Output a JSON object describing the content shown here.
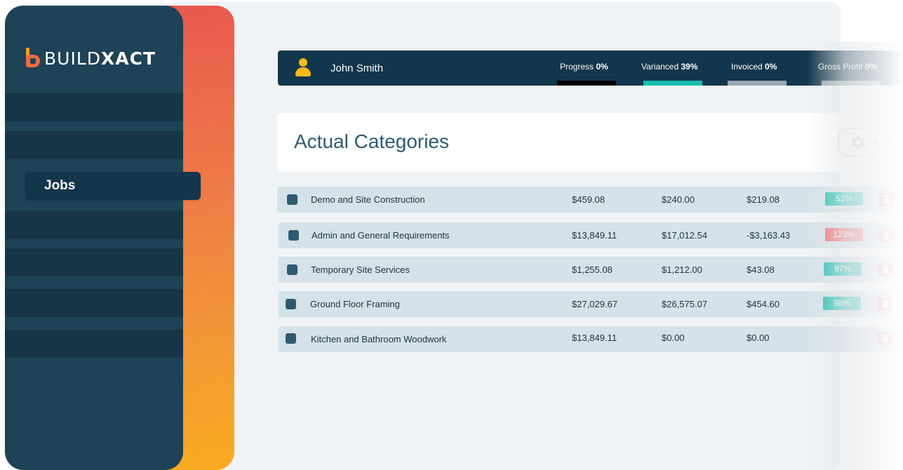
{
  "brand": {
    "logo_regular": "BUILD",
    "logo_bold": "XACT"
  },
  "sidebar": {
    "active_item": "Jobs"
  },
  "header": {
    "user_name": "John Smith",
    "stats": [
      {
        "label": "Progress",
        "value": "0%",
        "bar_color": "#000000"
      },
      {
        "label": "Varianced",
        "value": "39%",
        "bar_color": "#17bcae"
      },
      {
        "label": "Invoiced",
        "value": "0%",
        "bar_color": "#9aa7b0"
      },
      {
        "label": "Gross Profit",
        "value": "0%",
        "bar_color": "#9aa7b0"
      }
    ]
  },
  "card": {
    "title": "Actual Categories",
    "settings_icon": "gear-icon"
  },
  "colors": {
    "badge_ok": "#17bcae",
    "badge_over": "#f06a6e",
    "accent_from": "#e8574f",
    "accent_to": "#f7ac1f"
  },
  "rows": [
    {
      "name": "Demo and Site Construction",
      "budget": "$459.08",
      "actual": "$240.00",
      "variance": "$219.08",
      "percent": "52%",
      "status": "ok"
    },
    {
      "name": "Admin and General Requirements",
      "budget": "$13,849.11",
      "actual": "$17,012.54",
      "variance": "-$3,163.43",
      "percent": "123%",
      "status": "over"
    },
    {
      "name": "Temporary Site Services",
      "budget": "$1,255.08",
      "actual": "$1,212.00",
      "variance": "$43.08",
      "percent": "97%",
      "status": "ok"
    },
    {
      "name": "Ground Floor Framing",
      "budget": "$27,029.67",
      "actual": "$26,575.07",
      "variance": "$454.60",
      "percent": "98%",
      "status": "ok"
    },
    {
      "name": "Kitchen and Bathroom Woodwork",
      "budget": "$13,849.11",
      "actual": "$0.00",
      "variance": "$0.00",
      "percent": "",
      "status": "none"
    }
  ]
}
